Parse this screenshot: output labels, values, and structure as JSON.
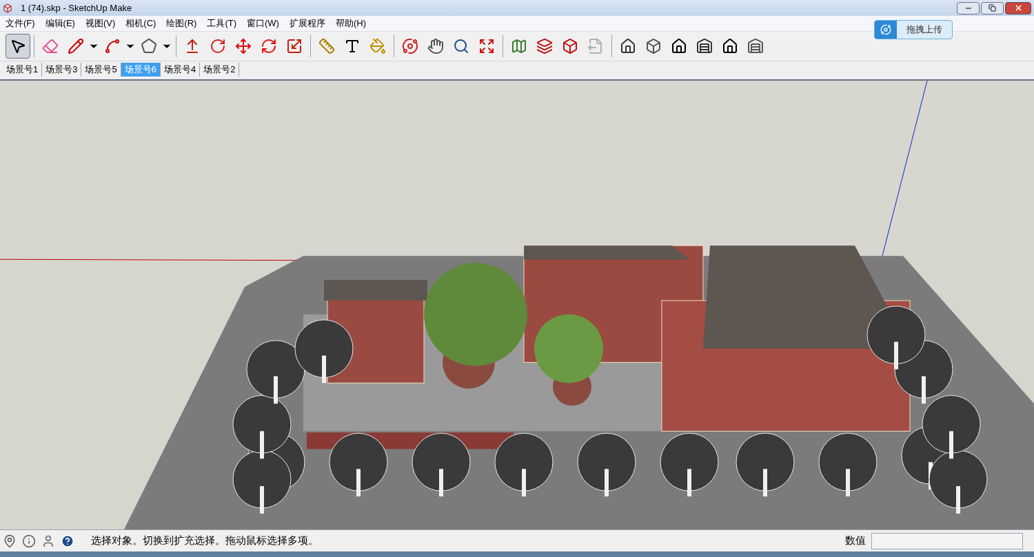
{
  "window": {
    "title": "1 (74).skp - SketchUp Make"
  },
  "menu": [
    "文件(F)",
    "编辑(E)",
    "视图(V)",
    "相机(C)",
    "绘图(R)",
    "工具(T)",
    "窗口(W)",
    "扩展程序",
    "帮助(H)"
  ],
  "upload_button": {
    "label": "拖拽上传"
  },
  "toolbar": {
    "select_tool": {
      "selected": true
    },
    "export_tool": {
      "disabled": true
    }
  },
  "scene_tabs": [
    {
      "label": "场景号1",
      "selected": false
    },
    {
      "label": "场景号3",
      "selected": false
    },
    {
      "label": "场景号5",
      "selected": false
    },
    {
      "label": "场景号6",
      "selected": true
    },
    {
      "label": "场景号4",
      "selected": false
    },
    {
      "label": "场景号2",
      "selected": false
    }
  ],
  "status_bar": {
    "message": "选择对象。切换到扩充选择。拖动鼠标选择多项。",
    "measurements_label": "数值"
  }
}
